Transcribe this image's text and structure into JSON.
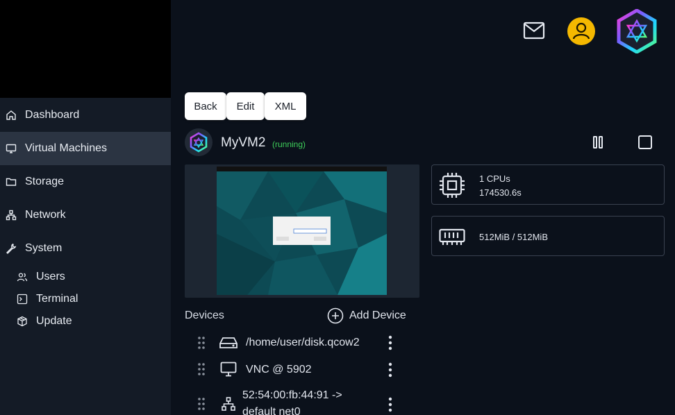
{
  "sidebar": {
    "items": [
      {
        "label": "Dashboard",
        "icon": "home-icon"
      },
      {
        "label": "Virtual Machines",
        "icon": "monitor-icon",
        "active": true
      },
      {
        "label": "Storage",
        "icon": "folder-icon"
      },
      {
        "label": "Network",
        "icon": "network-icon"
      },
      {
        "label": "System",
        "icon": "wrench-icon"
      }
    ],
    "sub_items": [
      {
        "label": "Users",
        "icon": "users-icon"
      },
      {
        "label": "Terminal",
        "icon": "terminal-icon"
      },
      {
        "label": "Update",
        "icon": "package-icon"
      }
    ]
  },
  "header": {
    "icons": [
      "mail-icon",
      "user-icon",
      "logo-icon"
    ],
    "user_avatar_color": "#f5b800"
  },
  "toolbar": {
    "back_label": "Back",
    "edit_label": "Edit",
    "xml_label": "XML"
  },
  "vm": {
    "name": "MyVM2",
    "status": "(running)",
    "status_color": "#3ecf5a",
    "pause_icon": "pause-icon",
    "stop_icon": "stop-icon"
  },
  "resources": {
    "cpu": {
      "count": "1 CPUs",
      "time": "174530.6s",
      "icon": "cpu-icon"
    },
    "memory": {
      "value": "512MiB / 512MiB",
      "icon": "memory-icon"
    }
  },
  "devices": {
    "label": "Devices",
    "add_label": "Add Device",
    "items": [
      {
        "text": "/home/user/disk.qcow2",
        "icon": "disk-icon"
      },
      {
        "text": "VNC @ 5902",
        "icon": "monitor-icon"
      },
      {
        "text": "52:54:00:fb:44:91 ->",
        "text2": "default net0",
        "icon": "network-icon"
      }
    ]
  },
  "colors": {
    "background": "#0b111b",
    "sidebar": "#141b26",
    "sidebar_active": "#2b3442",
    "card_border": "#3a4250"
  }
}
